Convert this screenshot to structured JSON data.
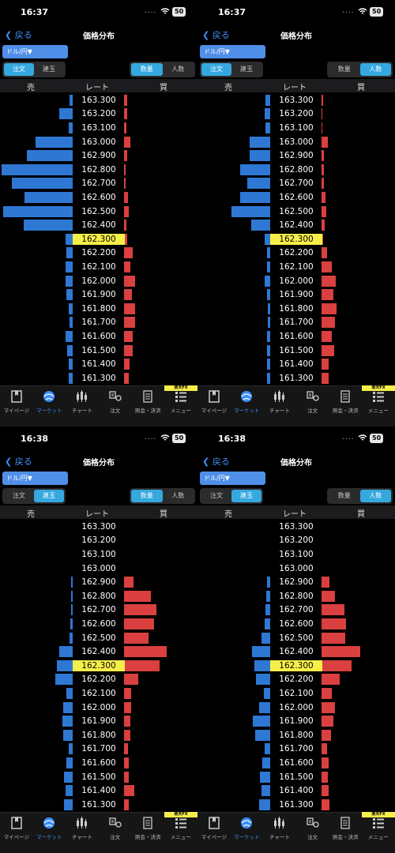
{
  "rates": [
    "163.300",
    "163.200",
    "163.100",
    "163.000",
    "162.900",
    "162.800",
    "162.700",
    "162.600",
    "162.500",
    "162.400",
    "162.300",
    "162.200",
    "162.100",
    "162.000",
    "161.900",
    "161.800",
    "161.700",
    "161.600",
    "161.500",
    "161.400",
    "161.300"
  ],
  "current_rate": "162.300",
  "pair_label": "ドル/円▼",
  "nav": {
    "back": "戻る",
    "title": "価格分布"
  },
  "segments": {
    "order": "注文",
    "position": "建玉",
    "quantity": "数量",
    "people": "人数"
  },
  "columns": {
    "sell": "売",
    "rate": "レート",
    "buy": "買"
  },
  "tabs": [
    "マイページ",
    "マーケット",
    "チャート",
    "注文",
    "照会・決済",
    "メニュー"
  ],
  "badge": "楽天FX",
  "colors": {
    "sell": "#2e78d4",
    "buy": "#d9403f",
    "current": "#f6ef4a",
    "accent": "#3b8ef6",
    "selected": "#35a8e0"
  },
  "panels": [
    {
      "time": "16:37",
      "battery": "50",
      "mode": "注文",
      "metric": "数量",
      "sell": [
        0.04,
        0.19,
        0.06,
        0.52,
        0.64,
        1.0,
        0.86,
        0.68,
        0.98,
        0.69,
        0.1,
        0.09,
        0.1,
        0.1,
        0.09,
        0.06,
        0.04,
        0.1,
        0.08,
        0.06,
        0.06
      ],
      "buy": [
        0.04,
        0.04,
        0.03,
        0.09,
        0.04,
        0.02,
        0.02,
        0.05,
        0.06,
        0.03,
        0.04,
        0.12,
        0.09,
        0.15,
        0.11,
        0.15,
        0.15,
        0.12,
        0.12,
        0.07,
        0.06
      ]
    },
    {
      "time": "16:37",
      "battery": "50",
      "mode": "注文",
      "metric": "人数",
      "sell": [
        0.07,
        0.08,
        0.07,
        0.29,
        0.29,
        0.42,
        0.32,
        0.42,
        0.55,
        0.27,
        0.08,
        0.05,
        0.05,
        0.08,
        0.05,
        0.03,
        0.03,
        0.05,
        0.05,
        0.05,
        0.05
      ],
      "buy": [
        0.02,
        0.01,
        0.01,
        0.09,
        0.03,
        0.03,
        0.03,
        0.05,
        0.06,
        0.04,
        0.02,
        0.07,
        0.14,
        0.19,
        0.16,
        0.2,
        0.18,
        0.14,
        0.17,
        0.1,
        0.1
      ]
    },
    {
      "time": "16:38",
      "battery": "50",
      "mode": "建玉",
      "metric": "数量",
      "sell": [
        0,
        0,
        0,
        0,
        0.02,
        0.02,
        0.02,
        0.03,
        0.04,
        0.19,
        0.22,
        0.25,
        0.09,
        0.13,
        0.14,
        0.13,
        0.06,
        0.09,
        0.12,
        0.1,
        0.12
      ],
      "buy": [
        0,
        0,
        0,
        0,
        0.13,
        0.37,
        0.44,
        0.41,
        0.33,
        0.58,
        0.48,
        0.19,
        0.1,
        0.1,
        0.09,
        0.09,
        0.05,
        0.06,
        0.06,
        0.14,
        0.06
      ]
    },
    {
      "time": "16:38",
      "battery": "50",
      "mode": "建玉",
      "metric": "人数",
      "sell": [
        0,
        0,
        0,
        0,
        0.04,
        0.06,
        0.07,
        0.08,
        0.12,
        0.26,
        0.22,
        0.2,
        0.09,
        0.16,
        0.25,
        0.21,
        0.08,
        0.11,
        0.15,
        0.12,
        0.16
      ],
      "buy": [
        0,
        0,
        0,
        0,
        0.11,
        0.18,
        0.31,
        0.33,
        0.32,
        0.53,
        0.41,
        0.25,
        0.14,
        0.18,
        0.16,
        0.13,
        0.08,
        0.1,
        0.09,
        0.1,
        0.11
      ]
    }
  ]
}
